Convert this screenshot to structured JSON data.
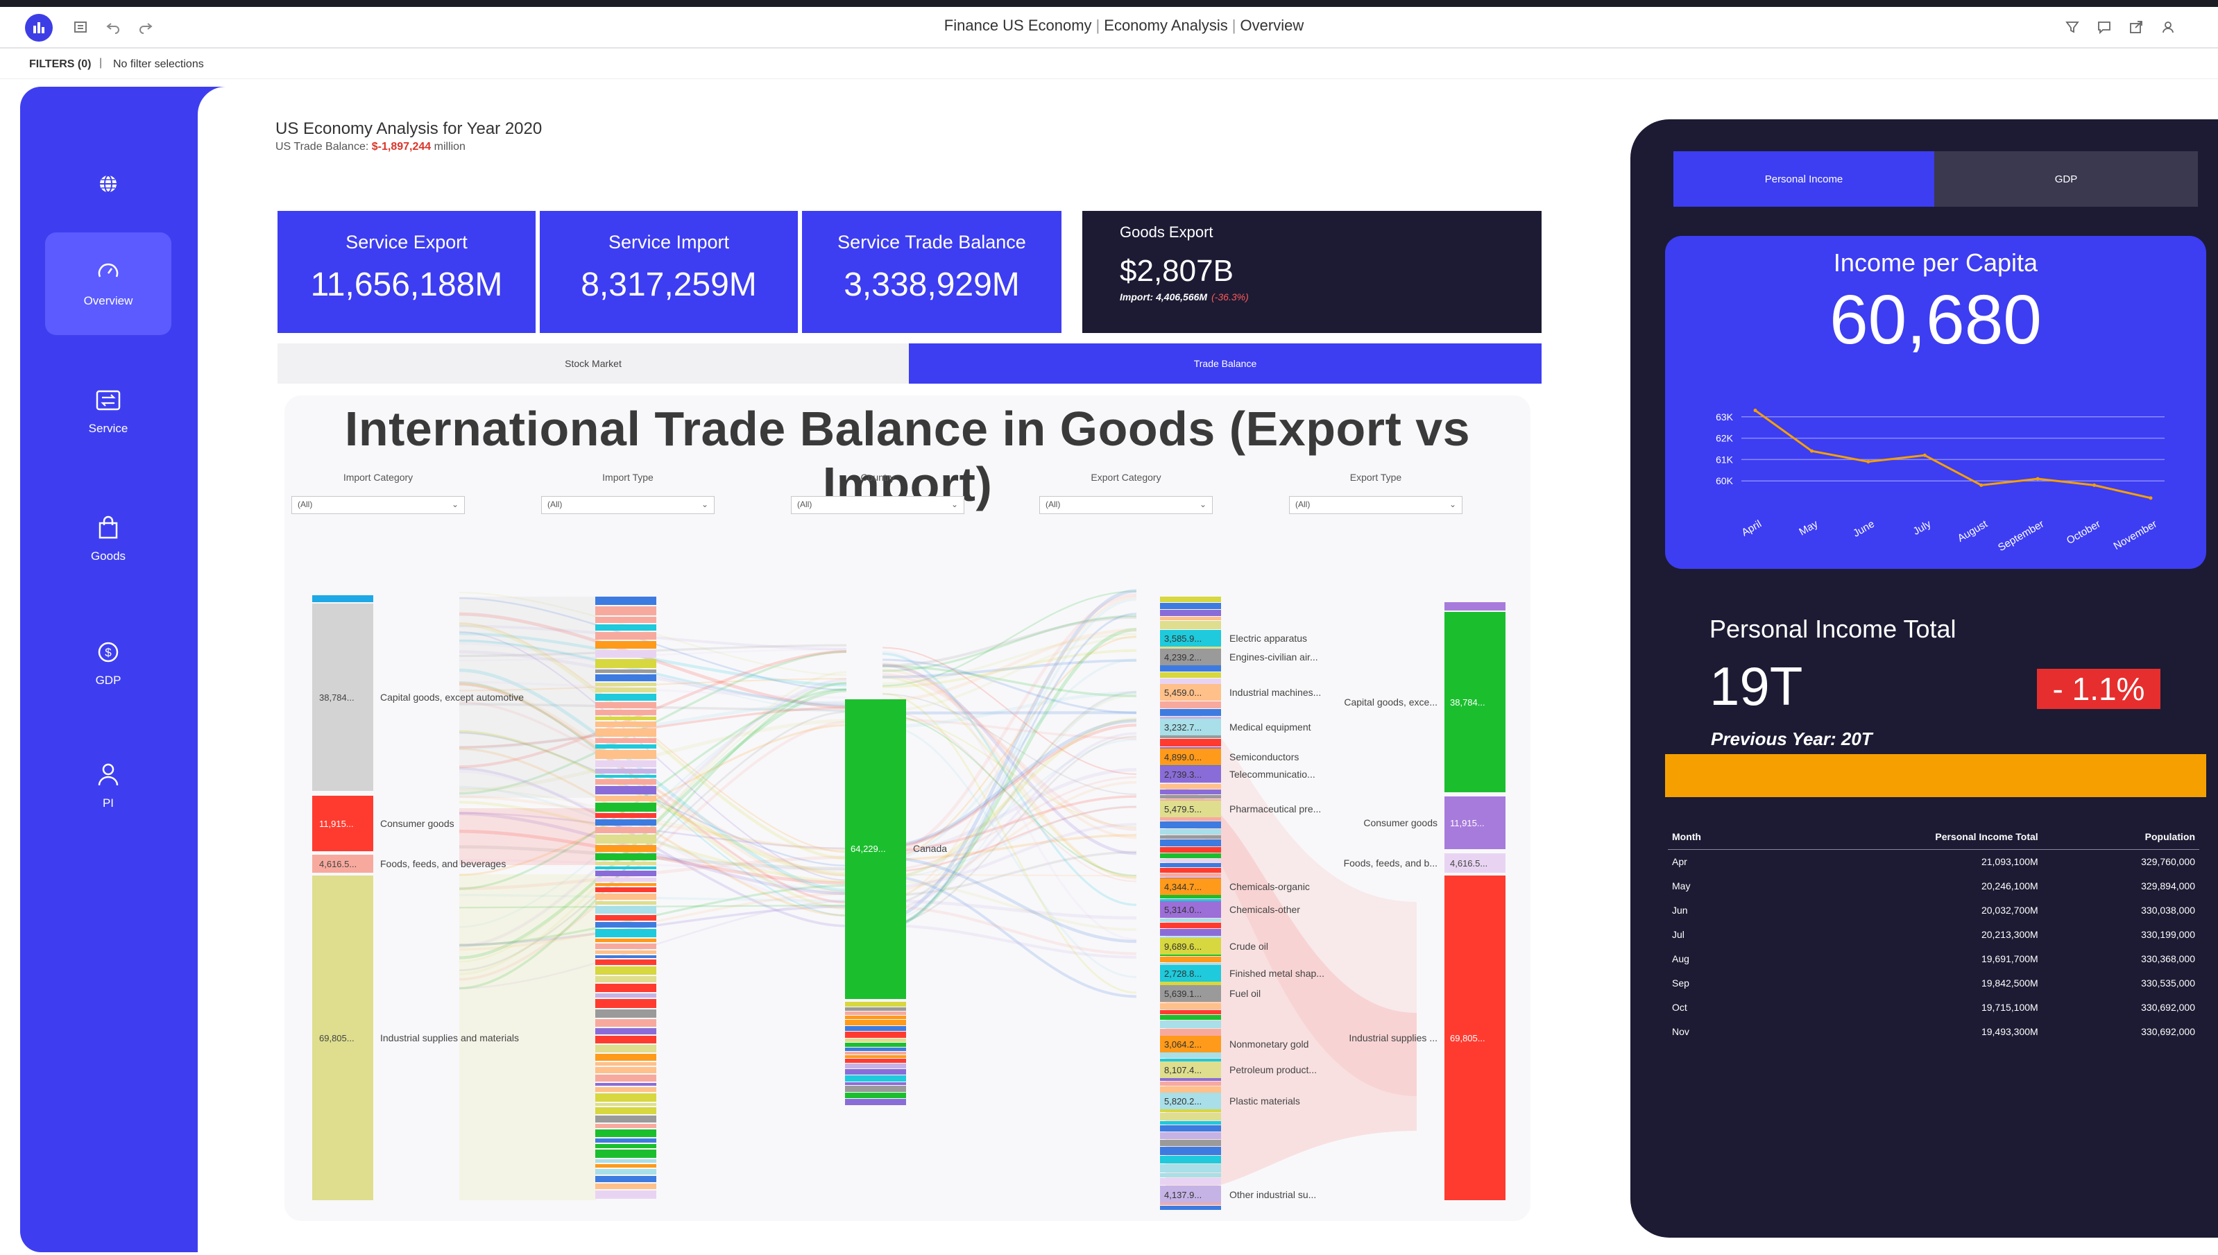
{
  "topbar": {
    "breadcrumb": [
      "Finance US Economy",
      "Economy Analysis",
      "Overview"
    ]
  },
  "filters": {
    "label": "FILTERS (0)",
    "value": "No filter selections"
  },
  "sidebar": {
    "items": [
      {
        "label": "",
        "icon": "globe-icon"
      },
      {
        "label": "Overview",
        "icon": "gauge-icon",
        "active": true
      },
      {
        "label": "Service",
        "icon": "exchange-icon"
      },
      {
        "label": "Goods",
        "icon": "shopping-bag-icon"
      },
      {
        "label": "GDP",
        "icon": "dollar-icon"
      },
      {
        "label": "PI",
        "icon": "person-icon"
      }
    ]
  },
  "header": {
    "title": "US Economy Analysis for Year 2020",
    "subtitle_prefix": "US Trade Balance:",
    "subtitle_value": "$-1,897,244",
    "subtitle_suffix": "million"
  },
  "kpis": [
    {
      "label": "Service Export",
      "value": "11,656,188M"
    },
    {
      "label": "Service Import",
      "value": "8,317,259M"
    },
    {
      "label": "Service Trade Balance",
      "value": "3,338,929M"
    }
  ],
  "goods_export": {
    "label": "Goods Export",
    "value": "$2,807B",
    "import_text": "Import: 4,406,566M",
    "pct": "(-36.3%)"
  },
  "tabs": [
    {
      "label": "Stock Market",
      "active": false
    },
    {
      "label": "Trade Balance",
      "active": true
    }
  ],
  "sankey": {
    "title": "International Trade Balance in Goods (Export vs Import)",
    "filters": [
      {
        "label": "Import Category",
        "value": "(All)"
      },
      {
        "label": "Import Type",
        "value": "(All)"
      },
      {
        "label": "Country",
        "value": "(All)"
      },
      {
        "label": "Export Category",
        "value": "(All)"
      },
      {
        "label": "Export Type",
        "value": "(All)"
      }
    ],
    "import_categories": [
      {
        "value": "38,784...",
        "label": "Capital goods, except automotive",
        "color": "#d3d3d3"
      },
      {
        "value": "11,915...",
        "label": "Consumer goods",
        "color": "#ff3b30"
      },
      {
        "value": "4,616.5...",
        "label": "Foods, feeds, and beverages",
        "color": "#f8a99e"
      },
      {
        "value": "69,805...",
        "label": "Industrial supplies and materials",
        "color": "#dede8e"
      }
    ],
    "country": {
      "value": "64,229...",
      "label": "Canada",
      "color": "#1bbf2e"
    },
    "export_types": [
      {
        "value": "3,585.9...",
        "label": "Electric apparatus",
        "color": "#1ecadb"
      },
      {
        "value": "4,239.2...",
        "label": "Engines-civilian air...",
        "color": "#9a9a9a"
      },
      {
        "value": "5,459.0...",
        "label": "Industrial machines...",
        "color": "#ffc08a"
      },
      {
        "value": "3,232.7...",
        "label": "Medical equipment",
        "color": "#a8dfe8"
      },
      {
        "value": "4,899.0...",
        "label": "Semiconductors",
        "color": "#ff9a1a"
      },
      {
        "value": "2,739.3...",
        "label": "Telecommunicatio...",
        "color": "#8a6cd8"
      },
      {
        "value": "5,479.5...",
        "label": "Pharmaceutical pre...",
        "color": "#dede8e"
      },
      {
        "value": "4,344.7...",
        "label": "Chemicals-organic",
        "color": "#ff9a1a"
      },
      {
        "value": "5,314.0...",
        "label": "Chemicals-other",
        "color": "#9c6ed8"
      },
      {
        "value": "9,689.6...",
        "label": "Crude oil",
        "color": "#d7d73f"
      },
      {
        "value": "2,728.8...",
        "label": "Finished metal shap...",
        "color": "#1ecadb"
      },
      {
        "value": "5,639.1...",
        "label": "Fuel oil",
        "color": "#9a9a9a"
      },
      {
        "value": "3,064.2...",
        "label": "Nonmonetary gold",
        "color": "#ff9a1a"
      },
      {
        "value": "8,107.4...",
        "label": "Petroleum product...",
        "color": "#dede8e"
      },
      {
        "value": "5,820.2...",
        "label": "Plastic materials",
        "color": "#a8dfe8"
      },
      {
        "value": "4,137.9...",
        "label": "Other industrial su...",
        "color": "#c5b3e6"
      }
    ],
    "export_categories": [
      {
        "value": "38,784...",
        "label": "Capital goods, exce...",
        "color": "#1bbf2e"
      },
      {
        "value": "11,915...",
        "label": "Consumer goods",
        "color": "#a77bdc"
      },
      {
        "value": "4,616.5...",
        "label": "Foods, feeds, and b...",
        "color": "#e8d4f2"
      },
      {
        "value": "69,805...",
        "label": "Industrial supplies ...",
        "color": "#ff3b30"
      }
    ]
  },
  "right_panel": {
    "tabs": [
      {
        "label": "Personal Income",
        "active": true
      },
      {
        "label": "GDP",
        "active": false
      }
    ],
    "income_per_capita": {
      "label": "Income per Capita",
      "value": "60,680"
    },
    "personal_income_total": {
      "label": "Personal Income Total",
      "value": "19T",
      "delta": "- 1.1%",
      "previous": "Previous Year: 20T"
    },
    "table": {
      "headers": [
        "Month",
        "Personal Income Total",
        "Population"
      ],
      "rows": [
        [
          "Apr",
          "21,093,100M",
          "329,760,000"
        ],
        [
          "May",
          "20,246,100M",
          "329,894,000"
        ],
        [
          "Jun",
          "20,032,700M",
          "330,038,000"
        ],
        [
          "Jul",
          "20,213,300M",
          "330,199,000"
        ],
        [
          "Aug",
          "19,691,700M",
          "330,368,000"
        ],
        [
          "Sep",
          "19,842,500M",
          "330,535,000"
        ],
        [
          "Oct",
          "19,715,100M",
          "330,692,000"
        ],
        [
          "Nov",
          "19,493,300M",
          "330,692,000"
        ]
      ]
    }
  },
  "chart_data": {
    "type": "line",
    "categories": [
      "April",
      "May",
      "June",
      "July",
      "August",
      "September",
      "October",
      "November"
    ],
    "values": [
      63300,
      61400,
      60900,
      61200,
      59800,
      60100,
      59800,
      59200
    ],
    "ylim": [
      59000,
      64000
    ],
    "yticks": [
      "60K",
      "61K",
      "62K",
      "63K"
    ],
    "grid": true,
    "color": "#f5a000"
  }
}
